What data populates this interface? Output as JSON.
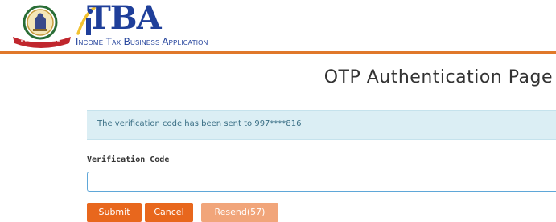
{
  "header": {
    "brand_title": "TBA",
    "brand_subtitle": "Income Tax Business Application",
    "emblem_icon": "government-emblem-icon",
    "accent_color": "#e0782a",
    "brand_color": "#1f3f9a"
  },
  "main": {
    "page_title": "OTP Authentication Page",
    "alert_message": "The verification code has been sent to 997****816",
    "field_label": "Verification Code",
    "input_value": "",
    "input_placeholder": ""
  },
  "buttons": {
    "submit_label": "Submit",
    "cancel_label": "Cancel",
    "resend_label": "Resend(57)",
    "primary_color": "#e8671d",
    "disabled_color": "#f1a57a"
  }
}
